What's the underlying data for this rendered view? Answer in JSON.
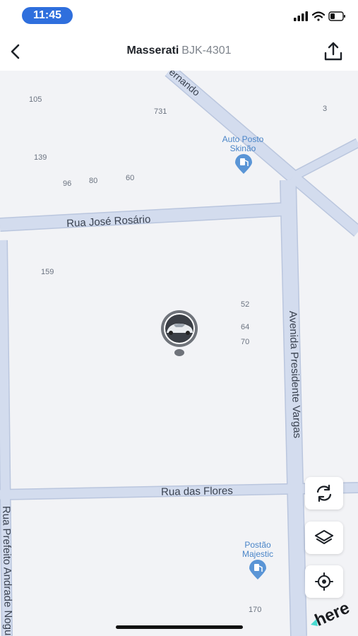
{
  "status": {
    "time": "11:45"
  },
  "header": {
    "model": "Masserati",
    "plate": "BJK-4301"
  },
  "map": {
    "streets": {
      "top_diag": "Fernando",
      "rosario": "Rua José Rosário",
      "vargas": "Avenida Presidente Vargas",
      "flores": "Rua das Flores",
      "prefeito": "Rua Prefeito Andrade Nogu"
    },
    "pois": [
      {
        "line1": "Auto Posto",
        "line2": "Skinão"
      },
      {
        "line1": "Postão",
        "line2": "Majestic"
      }
    ],
    "house_numbers": [
      "105",
      "731",
      "3",
      "139",
      "96",
      "80",
      "60",
      "159",
      "52",
      "64",
      "70",
      "170"
    ],
    "logo": "here"
  },
  "colors": {
    "accent": "#2f6fdd",
    "road": "#cdd7ea",
    "road_edge": "#bac6de",
    "poi": "#5a95d6",
    "map_bg": "#f2f3f6"
  },
  "icons": [
    "back-icon",
    "share-icon",
    "refresh-icon",
    "layers-icon",
    "locate-icon",
    "gas-station-icon",
    "car-marker-icon"
  ]
}
